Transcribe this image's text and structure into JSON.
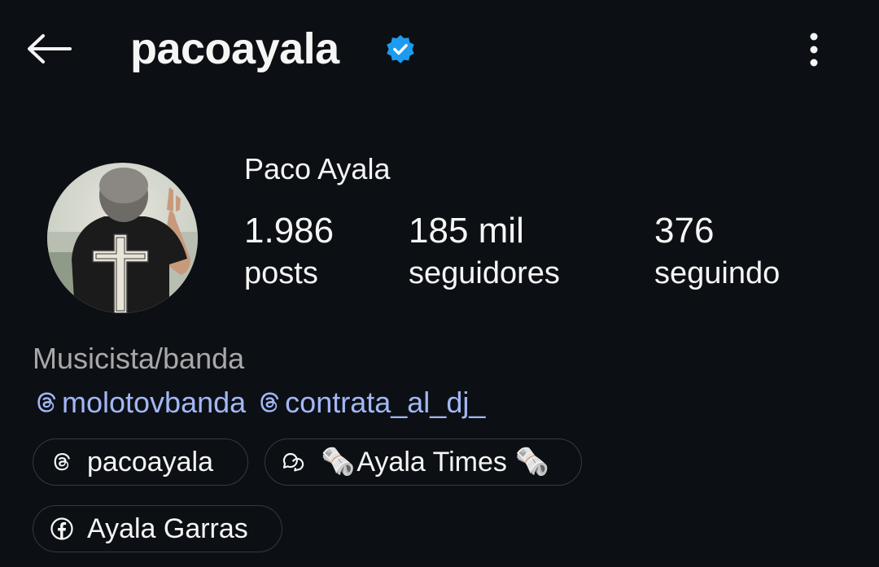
{
  "header": {
    "username": "pacoayala",
    "back_icon": "arrow-left-icon",
    "verified_icon": "verified-badge-icon",
    "more_icon": "more-vertical-icon",
    "verified_color": "#1d9bf0"
  },
  "profile": {
    "display_name": "Paco Ayala",
    "avatar_icon": "profile-photo",
    "stats": [
      {
        "value": "1.986",
        "label": "posts"
      },
      {
        "value": "185 mil",
        "label": "seguidores"
      },
      {
        "value": "376",
        "label": "seguindo"
      }
    ],
    "category": "Musicista/banda",
    "mentions": [
      "molotovbanda",
      "contrata_al_dj_"
    ],
    "mention_color": "#a3b7f6",
    "links": [
      {
        "icon": "threads-icon",
        "label": "pacoayala"
      },
      {
        "icon": "chat-bubble-icon",
        "emoji": "🗞️",
        "label": "Ayala Times"
      },
      {
        "icon": "facebook-icon",
        "label": "Ayala Garras"
      }
    ]
  }
}
